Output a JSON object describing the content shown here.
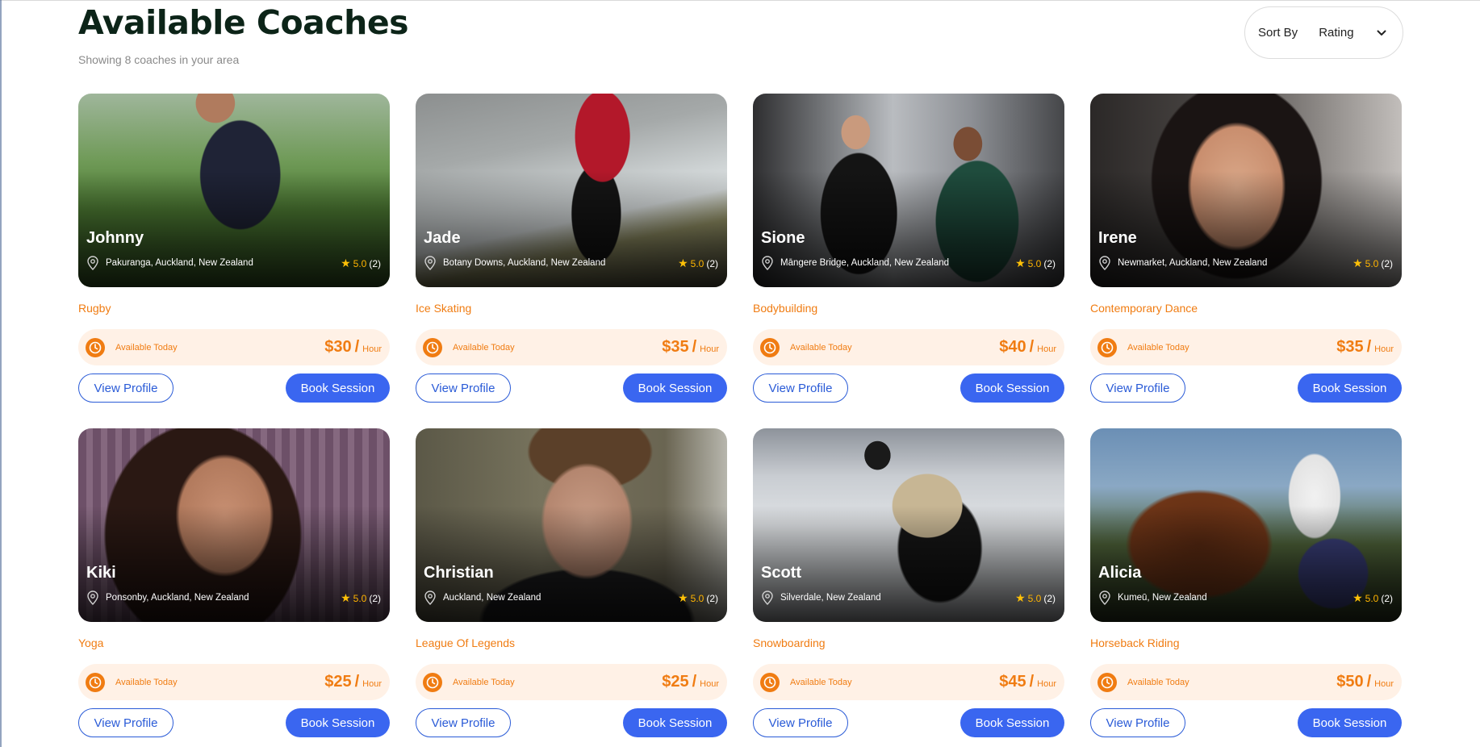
{
  "header": {
    "title": "Available Coaches",
    "subtitle": "Showing 8 coaches in your area",
    "sort_label": "Sort By",
    "sort_value": "Rating"
  },
  "labels": {
    "available": "Available Today",
    "per": "Hour",
    "slash": "/",
    "view_profile": "View Profile",
    "book_session": "Book Session"
  },
  "coaches": [
    {
      "name": "Johnny",
      "location": "Pakuranga, Auckland, New Zealand",
      "rating": "5.0",
      "reviews": "(2)",
      "sport": "Rugby",
      "price": "$30"
    },
    {
      "name": "Jade",
      "location": "Botany Downs, Auckland, New Zealand",
      "rating": "5.0",
      "reviews": "(2)",
      "sport": "Ice Skating",
      "price": "$35"
    },
    {
      "name": "Sione",
      "location": "Māngere Bridge, Auckland, New Zealand",
      "rating": "5.0",
      "reviews": "(2)",
      "sport": "Bodybuilding",
      "price": "$40"
    },
    {
      "name": "Irene",
      "location": "Newmarket, Auckland, New Zealand",
      "rating": "5.0",
      "reviews": "(2)",
      "sport": "Contemporary Dance",
      "price": "$35"
    },
    {
      "name": "Kiki",
      "location": "Ponsonby, Auckland, New Zealand",
      "rating": "5.0",
      "reviews": "(2)",
      "sport": "Yoga",
      "price": "$25"
    },
    {
      "name": "Christian",
      "location": "Auckland, New Zealand",
      "rating": "5.0",
      "reviews": "(2)",
      "sport": "League Of Legends",
      "price": "$25"
    },
    {
      "name": "Scott",
      "location": "Silverdale, New Zealand",
      "rating": "5.0",
      "reviews": "(2)",
      "sport": "Snowboarding",
      "price": "$45"
    },
    {
      "name": "Alicia",
      "location": "Kumeū, New Zealand",
      "rating": "5.0",
      "reviews": "(2)",
      "sport": "Horseback Riding",
      "price": "$50"
    }
  ],
  "colors": {
    "accent_orange": "#f07c12",
    "primary_blue": "#3a66f0",
    "star": "#ffc107"
  }
}
